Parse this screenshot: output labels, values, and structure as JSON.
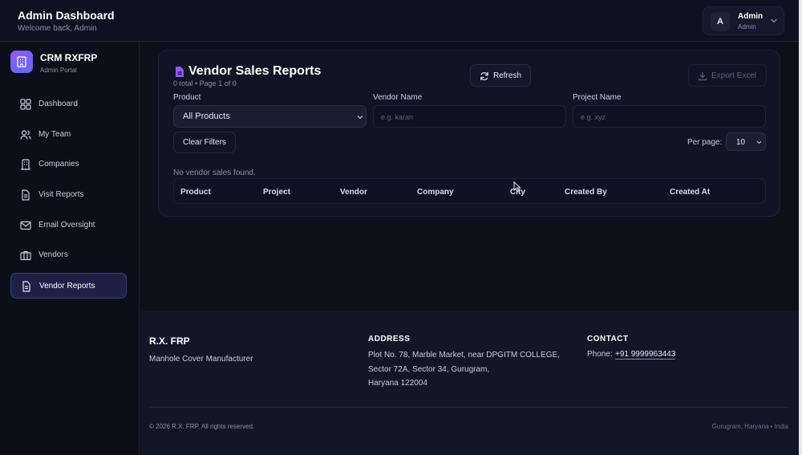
{
  "header": {
    "title": "Admin Dashboard",
    "subtitle": "Welcome back, Admin",
    "user": {
      "initial": "A",
      "name": "Admin",
      "role": "Admin"
    }
  },
  "sidebar": {
    "brand_name": "CRM RXFRP",
    "brand_sub": "Admin Portal",
    "items": [
      {
        "label": "Dashboard",
        "icon": "grid-icon"
      },
      {
        "label": "My Team",
        "icon": "users-icon"
      },
      {
        "label": "Companies",
        "icon": "building-icon"
      },
      {
        "label": "Visit Reports",
        "icon": "document-icon"
      },
      {
        "label": "Email Oversight",
        "icon": "mail-icon"
      },
      {
        "label": "Vendors",
        "icon": "briefcase-icon"
      },
      {
        "label": "Vendor Reports",
        "icon": "document-icon",
        "active": true
      }
    ]
  },
  "report": {
    "title": "Vendor Sales Reports",
    "count": "0 total • Page 1 of 0",
    "refresh_label": "Refresh",
    "export_label": "Export Excel",
    "filters": {
      "product_label": "Product",
      "product_value": "All Products",
      "vendor_label": "Vendor Name",
      "vendor_placeholder": "e.g. karan",
      "project_label": "Project Name",
      "project_placeholder": "e.g. xyz",
      "clear_label": "Clear Filters",
      "per_page_label": "Per page:",
      "per_page_value": "10"
    },
    "empty_message": "No vendor sales found.",
    "columns": [
      "Product",
      "Project",
      "Vendor",
      "Company",
      "City",
      "Created By",
      "Created At"
    ]
  },
  "footer": {
    "brand": "R.X. FRP",
    "tagline": "Manhole Cover Manufacturer",
    "address_heading": "ADDRESS",
    "address_lines": [
      "Plot No. 78, Marble Market, near DPGITM COLLEGE,",
      "Sector 72A, Sector 34, Gurugram,",
      "Haryana 122004"
    ],
    "contact_heading": "CONTACT",
    "phone_label": "Phone:",
    "phone": "+91 9999963443",
    "copyright": "© 2026 R.X. FRP. All rights reserved.",
    "location": "Gurugram, Haryana • India"
  },
  "colors": {
    "accent": "#8b5cf6",
    "background": "#0d0f1a",
    "card": "#111425",
    "active_nav": "#1e2046"
  }
}
